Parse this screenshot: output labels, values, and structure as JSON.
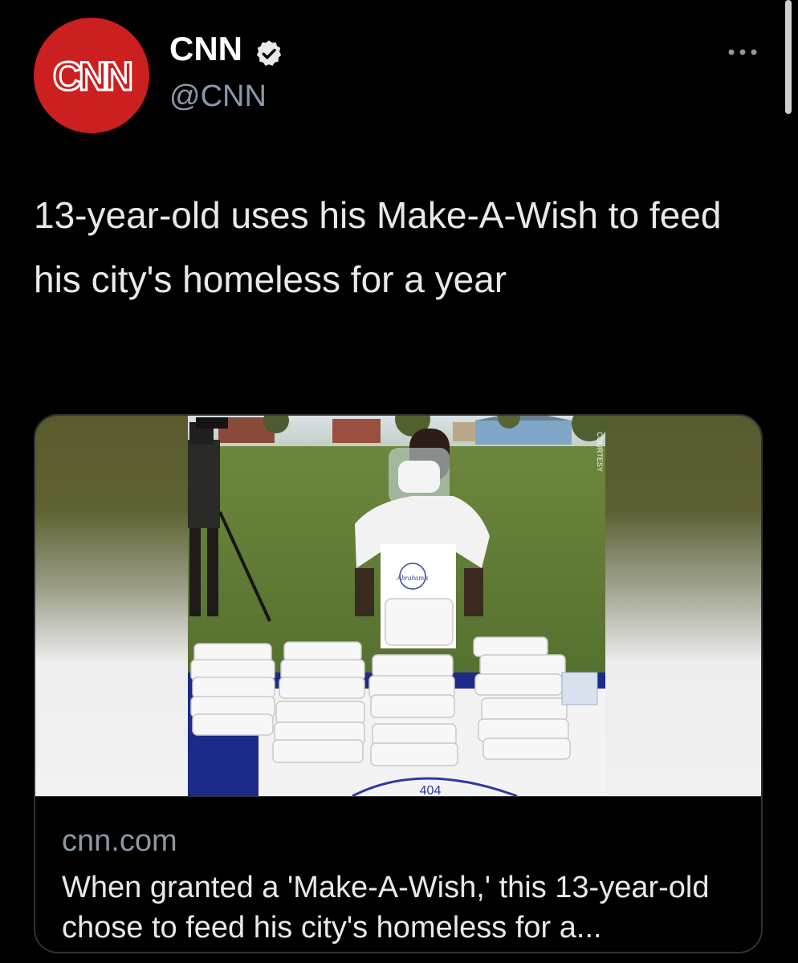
{
  "tweet": {
    "author": {
      "name": "CNN",
      "handle": "@CNN",
      "avatar_text": "CNN",
      "verified_icon": "verified-badge-icon",
      "avatar_color": "#cc1f1f"
    },
    "more_icon": "more-horizontal-icon",
    "text": "13-year-old uses his Make-A-Wish to feed his city's homeless for a year"
  },
  "link_card": {
    "domain": "cnn.com",
    "description": "When granted a 'Make-A-Wish,' this 13-year-old chose to feed his city's homeless for a...",
    "image_credit": "COURTESY",
    "image_apron_text": "Abraham's",
    "image_table_text": "404"
  },
  "colors": {
    "background": "#000000",
    "text_primary": "#e7e9ea",
    "text_secondary": "#8b98a5",
    "border": "#2f3336"
  }
}
